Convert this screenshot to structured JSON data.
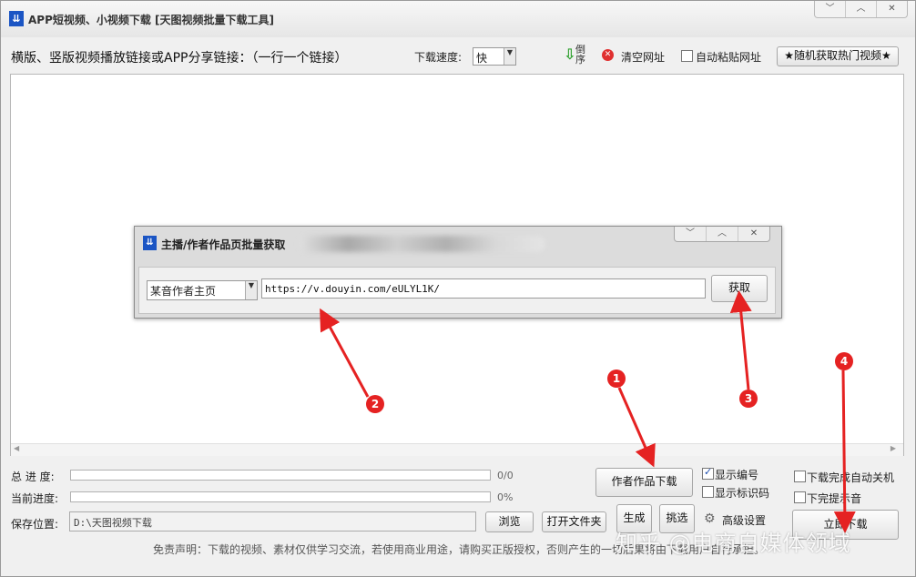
{
  "window": {
    "title": "APP短视频、小视频下载 [天图视频批量下载工具]",
    "icon": "download-app-icon"
  },
  "toolbar": {
    "main_label": "横版、竖版视频播放链接或APP分享链接：（一行一个链接）",
    "speed_label": "下载速度:",
    "speed_value": "快",
    "reverse_label": "倒序",
    "clear_label": "清空网址",
    "auto_paste_label": "自动粘贴网址",
    "random_hot_label": "★随机获取热门视频★"
  },
  "progress": {
    "total_label": "总 进 度:",
    "total_value": "0/0",
    "total_fraction": 0,
    "current_label": "当前进度:",
    "current_value": "0%",
    "current_fraction": 0
  },
  "save": {
    "label": "保存位置:",
    "path": "D:\\天图视频下载",
    "browse_label": "浏览",
    "open_folder_label": "打开文件夹"
  },
  "actions": {
    "author_download_label": "作者作品下载",
    "generate_label": "生成",
    "pick_label": "挑选",
    "show_number_label": "显示编号",
    "show_number_checked": true,
    "show_tag_label": "显示标识码",
    "show_tag_checked": false,
    "advanced_label": "高级设置",
    "auto_shutdown_label": "下载完成自动关机",
    "auto_shutdown_checked": false,
    "notify_sound_label": "下完提示音",
    "notify_sound_checked": false,
    "download_now_label": "立即下载"
  },
  "disclaimer": "免责声明：下载的视频、素材仅供学习交流，若使用商业用途，请购买正版授权，否则产生的一切后果将由下载用户自行承担。",
  "dialog": {
    "title": "主播/作者作品页批量获取",
    "source_value": "某音作者主页",
    "url_value": "https://v.douyin.com/eULYL1K/",
    "fetch_label": "获取"
  },
  "annotations": [
    "1",
    "2",
    "3",
    "4"
  ],
  "watermark": "知乎 @电商自媒体领域",
  "colors": {
    "accent": "#1b55c4",
    "annotation_red": "#e52222",
    "clear_icon_red": "#e03030"
  }
}
